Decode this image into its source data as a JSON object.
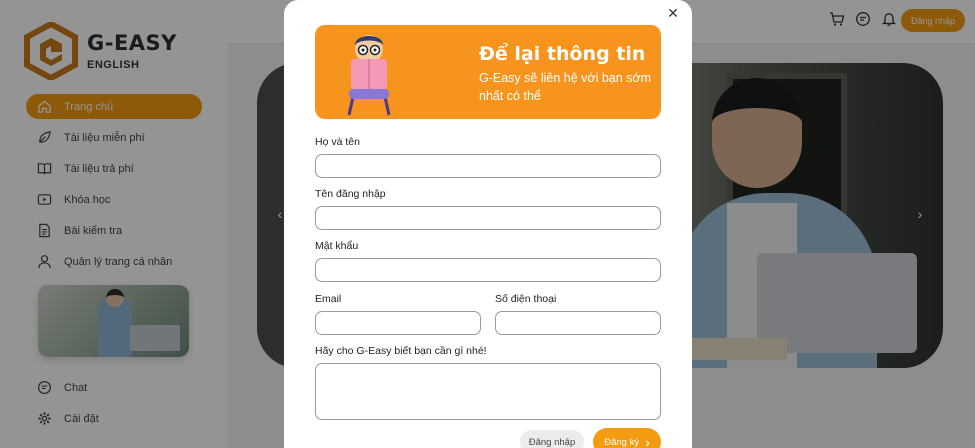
{
  "brand": {
    "title": "G-EASY",
    "subtitle": "ENGLISH",
    "accent": "#f39c12"
  },
  "sidebar": {
    "items": [
      {
        "label": "Trang chủ",
        "icon": "home-icon",
        "active": true
      },
      {
        "label": "Tài liệu miễn phí",
        "icon": "leaf-icon"
      },
      {
        "label": "Tài liệu trả phí",
        "icon": "book-icon"
      },
      {
        "label": "Khóa học",
        "icon": "video-icon"
      },
      {
        "label": "Bài kiểm tra",
        "icon": "document-icon"
      },
      {
        "label": "Quản lý trang cá nhân",
        "icon": "user-icon"
      }
    ],
    "bottom_items": [
      {
        "label": "Chat",
        "icon": "chat-icon"
      },
      {
        "label": "Cài đặt",
        "icon": "gear-icon"
      }
    ]
  },
  "header": {
    "icons": [
      "cart-icon",
      "message-icon",
      "bell-icon"
    ],
    "login_label": "Đăng nhập"
  },
  "banner": {
    "prev": "‹",
    "next": "›"
  },
  "modal": {
    "close": "✕",
    "hero_title": "Để lại thông tin",
    "hero_subtitle": "G-Easy sẽ liên hệ với bạn sớm nhất có thể",
    "fields": {
      "fullname_label": "Họ và tên",
      "username_label": "Tên đăng nhập",
      "password_label": "Mật khẩu",
      "email_label": "Email",
      "phone_label": "Số điện thoại",
      "message_label": "Hãy cho G-Easy biết bạn cần gì nhé!"
    },
    "login_label": "Đăng nhập",
    "register_label": "Đăng ký",
    "register_arrow": "›"
  }
}
